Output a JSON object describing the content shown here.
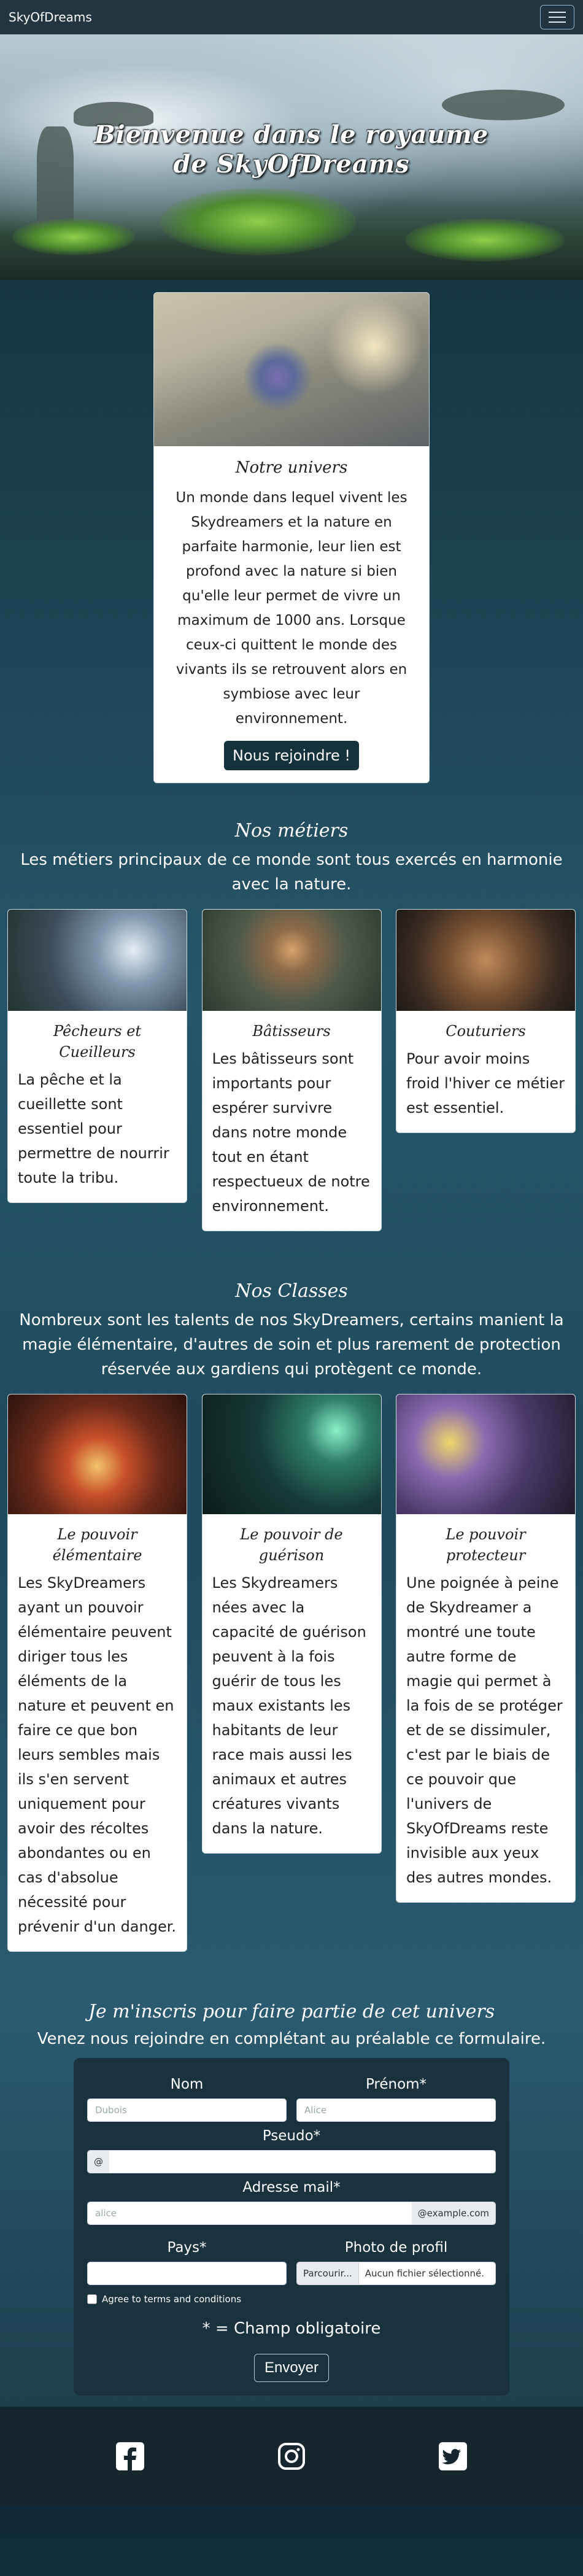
{
  "navbar": {
    "brand": "SkyOfDreams"
  },
  "hero": {
    "title_line1": "Bienvenue dans le royaume",
    "title_line2": "de SkyOfDreams"
  },
  "univers": {
    "title": "Notre univers",
    "text": "Un monde dans lequel vivent les Skydreamers et la nature en parfaite harmonie, leur lien est profond avec la nature si bien qu'elle leur permet de vivre un maximum de 1000 ans. Lorsque ceux-ci quittent le monde des vivants ils se retrouvent alors en symbiose avec leur environnement.",
    "button": "Nous rejoindre !"
  },
  "metiers": {
    "title": "Nos métiers",
    "desc": "Les métiers principaux de ce monde sont tous exercés en harmonie avec la nature.",
    "cards": [
      {
        "title": "Pêcheurs et Cueilleurs",
        "text": "La pêche et la cueillette sont essentiel pour permettre de nourrir toute la tribu."
      },
      {
        "title": "Bâtisseurs",
        "text": "Les bâtisseurs sont importants pour espérer survivre dans notre monde tout en étant respectueux de notre environnement."
      },
      {
        "title": "Couturiers",
        "text": "Pour avoir moins froid l'hiver ce métier est essentiel."
      }
    ]
  },
  "classes": {
    "title": "Nos Classes",
    "desc": "Nombreux sont les talents de nos SkyDreamers, certains manient la magie élémentaire, d'autres de soin et plus rarement de protection réservée aux gardiens qui protègent ce monde.",
    "cards": [
      {
        "title": "Le pouvoir élémentaire",
        "text": "Les SkyDreamers ayant un pouvoir élémentaire peuvent diriger tous les éléments de la nature et peuvent en faire ce que bon leurs sembles mais ils s'en servent uniquement pour avoir des récoltes abondantes ou en cas d'absolue nécessité pour prévenir d'un danger."
      },
      {
        "title": "Le pouvoir de guérison",
        "text": "Les Skydreamers nées avec la capacité de guérison peuvent à la fois guérir de tous les maux existants les habitants de leur race mais aussi les animaux et autres créatures vivants dans la nature."
      },
      {
        "title": "Le pouvoir protecteur",
        "text": "Une poignée à peine de Skydreamer a montré une toute autre forme de magie qui permet à la fois de se protéger et de se dissimuler, c'est par le biais de ce pouvoir que l'univers de SkyOfDreams reste invisible aux yeux des autres mondes."
      }
    ]
  },
  "join": {
    "title": "Je m'inscris pour faire partie de cet univers",
    "desc": "Venez nous rejoindre en complétant au préalable ce formulaire."
  },
  "form": {
    "nom_label": "Nom",
    "nom_placeholder": "Dubois",
    "prenom_label": "Prénom*",
    "prenom_placeholder": "Alice",
    "pseudo_label": "Pseudo*",
    "pseudo_addon": "@",
    "email_label": "Adresse mail*",
    "email_placeholder": "alice",
    "email_addon": "@example.com",
    "pays_label": "Pays*",
    "photo_label": "Photo de profil",
    "file_button": "Parcourir...",
    "file_text": "Aucun fichier sélectionné.",
    "terms": "Agree to terms and conditions",
    "required_note": "* = Champ obligatoire",
    "submit": "Envoyer"
  },
  "footer": {
    "icons": [
      "facebook-icon",
      "instagram-icon",
      "twitter-icon"
    ]
  }
}
